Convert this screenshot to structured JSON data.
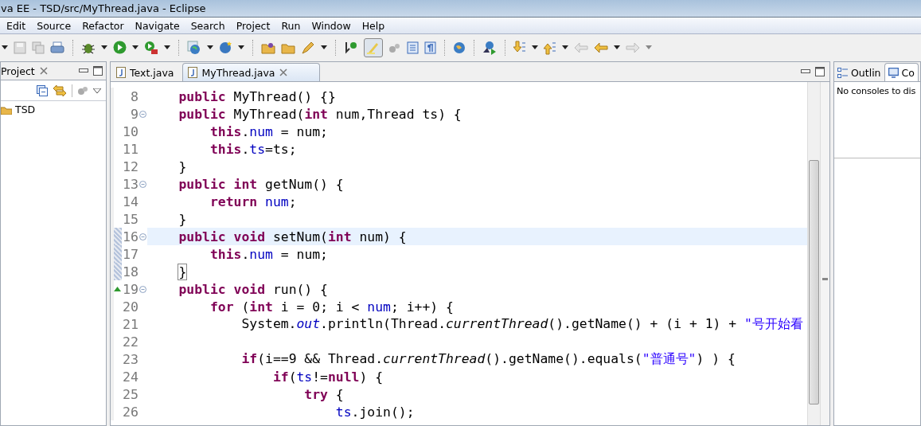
{
  "window": {
    "title": "va EE - TSD/src/MyThread.java - Eclipse"
  },
  "menu": [
    "Edit",
    "Source",
    "Refactor",
    "Navigate",
    "Search",
    "Project",
    "Run",
    "Window",
    "Help"
  ],
  "project_explorer": {
    "title": "Project",
    "tree": [
      {
        "label": "TSD"
      }
    ]
  },
  "editor": {
    "tabs": [
      {
        "label": "Text.java",
        "selected": false
      },
      {
        "label": "MyThread.java",
        "selected": true
      }
    ],
    "lines": [
      {
        "number": "8",
        "fold": false,
        "current": false,
        "changed": false,
        "override": false,
        "tokens": [
          {
            "kind": "k",
            "text": "    public"
          },
          {
            "kind": "p",
            "text": " MyThread() {}"
          }
        ]
      },
      {
        "number": "9",
        "fold": true,
        "current": false,
        "changed": false,
        "override": false,
        "tokens": [
          {
            "kind": "k",
            "text": "    public"
          },
          {
            "kind": "p",
            "text": " MyThread("
          },
          {
            "kind": "k",
            "text": "int"
          },
          {
            "kind": "p",
            "text": " num,Thread ts) {"
          }
        ]
      },
      {
        "number": "10",
        "fold": false,
        "current": false,
        "changed": false,
        "override": false,
        "tokens": [
          {
            "kind": "k",
            "text": "        this"
          },
          {
            "kind": "p",
            "text": "."
          },
          {
            "kind": "f",
            "text": "num"
          },
          {
            "kind": "p",
            "text": " = num;"
          }
        ]
      },
      {
        "number": "11",
        "fold": false,
        "current": false,
        "changed": false,
        "override": false,
        "tokens": [
          {
            "kind": "k",
            "text": "        this"
          },
          {
            "kind": "p",
            "text": "."
          },
          {
            "kind": "f",
            "text": "ts"
          },
          {
            "kind": "p",
            "text": "=ts;"
          }
        ]
      },
      {
        "number": "12",
        "fold": false,
        "current": false,
        "changed": false,
        "override": false,
        "tokens": [
          {
            "kind": "p",
            "text": "    }"
          }
        ]
      },
      {
        "number": "13",
        "fold": true,
        "current": false,
        "changed": false,
        "override": false,
        "tokens": [
          {
            "kind": "k",
            "text": "    public int"
          },
          {
            "kind": "p",
            "text": " getNum() {"
          }
        ]
      },
      {
        "number": "14",
        "fold": false,
        "current": false,
        "changed": false,
        "override": false,
        "tokens": [
          {
            "kind": "k",
            "text": "        return"
          },
          {
            "kind": "f",
            "text": " num"
          },
          {
            "kind": "p",
            "text": ";"
          }
        ]
      },
      {
        "number": "15",
        "fold": false,
        "current": false,
        "changed": false,
        "override": false,
        "tokens": [
          {
            "kind": "p",
            "text": "    }"
          }
        ]
      },
      {
        "number": "16",
        "fold": true,
        "current": true,
        "changed": true,
        "override": false,
        "tokens": [
          {
            "kind": "k",
            "text": "    public void"
          },
          {
            "kind": "p",
            "text": " setNum("
          },
          {
            "kind": "k",
            "text": "int"
          },
          {
            "kind": "p",
            "text": " num) {"
          }
        ]
      },
      {
        "number": "17",
        "fold": false,
        "current": false,
        "changed": true,
        "override": false,
        "tokens": [
          {
            "kind": "k",
            "text": "        this"
          },
          {
            "kind": "p",
            "text": "."
          },
          {
            "kind": "f",
            "text": "num"
          },
          {
            "kind": "p",
            "text": " = num;"
          }
        ]
      },
      {
        "number": "18",
        "fold": false,
        "current": false,
        "changed": true,
        "override": false,
        "tokens": [
          {
            "kind": "m",
            "text": "    }"
          }
        ]
      },
      {
        "number": "19",
        "fold": true,
        "current": false,
        "changed": false,
        "override": true,
        "tokens": [
          {
            "kind": "k",
            "text": "    public void"
          },
          {
            "kind": "p",
            "text": " run() {"
          }
        ]
      },
      {
        "number": "20",
        "fold": false,
        "current": false,
        "changed": false,
        "override": false,
        "tokens": [
          {
            "kind": "k",
            "text": "        for"
          },
          {
            "kind": "p",
            "text": " ("
          },
          {
            "kind": "k",
            "text": "int"
          },
          {
            "kind": "p",
            "text": " i = 0; i < "
          },
          {
            "kind": "f",
            "text": "num"
          },
          {
            "kind": "p",
            "text": "; i++) {"
          }
        ]
      },
      {
        "number": "21",
        "fold": false,
        "current": false,
        "changed": false,
        "override": false,
        "tokens": [
          {
            "kind": "p",
            "text": "            System."
          },
          {
            "kind": "s",
            "text": "out"
          },
          {
            "kind": "p",
            "text": ".println(Thread."
          },
          {
            "kind": "i",
            "text": "currentThread"
          },
          {
            "kind": "p",
            "text": "().getName() + (i + 1) + "
          },
          {
            "kind": "t",
            "text": "\"号开始看"
          }
        ]
      },
      {
        "number": "22",
        "fold": false,
        "current": false,
        "changed": false,
        "override": false
      },
      {
        "number": "23",
        "fold": false,
        "current": false,
        "changed": false,
        "override": false,
        "tokens": [
          {
            "kind": "k",
            "text": "            if"
          },
          {
            "kind": "p",
            "text": "(i==9 && Thread."
          },
          {
            "kind": "i",
            "text": "currentThread"
          },
          {
            "kind": "p",
            "text": "().getName().equals("
          },
          {
            "kind": "t",
            "text": "\"普通号\""
          },
          {
            "kind": "p",
            "text": ") ) {"
          }
        ]
      },
      {
        "number": "24",
        "fold": false,
        "current": false,
        "changed": false,
        "override": false,
        "tokens": [
          {
            "kind": "k",
            "text": "                if"
          },
          {
            "kind": "p",
            "text": "("
          },
          {
            "kind": "f",
            "text": "ts"
          },
          {
            "kind": "p",
            "text": "!="
          },
          {
            "kind": "k",
            "text": "null"
          },
          {
            "kind": "p",
            "text": ") {"
          }
        ]
      },
      {
        "number": "25",
        "fold": false,
        "current": false,
        "changed": false,
        "override": false,
        "tokens": [
          {
            "kind": "k",
            "text": "                    try"
          },
          {
            "kind": "p",
            "text": " {"
          }
        ]
      },
      {
        "number": "26",
        "fold": false,
        "current": false,
        "changed": false,
        "override": false,
        "tokens": [
          {
            "kind": "f",
            "text": "                        ts"
          },
          {
            "kind": "p",
            "text": ".join();"
          }
        ]
      }
    ]
  },
  "side_panel": {
    "tabs": [
      {
        "label": "Outlin",
        "selected": false
      },
      {
        "label": "Co",
        "selected": true
      }
    ],
    "message": "No consoles to dis"
  }
}
